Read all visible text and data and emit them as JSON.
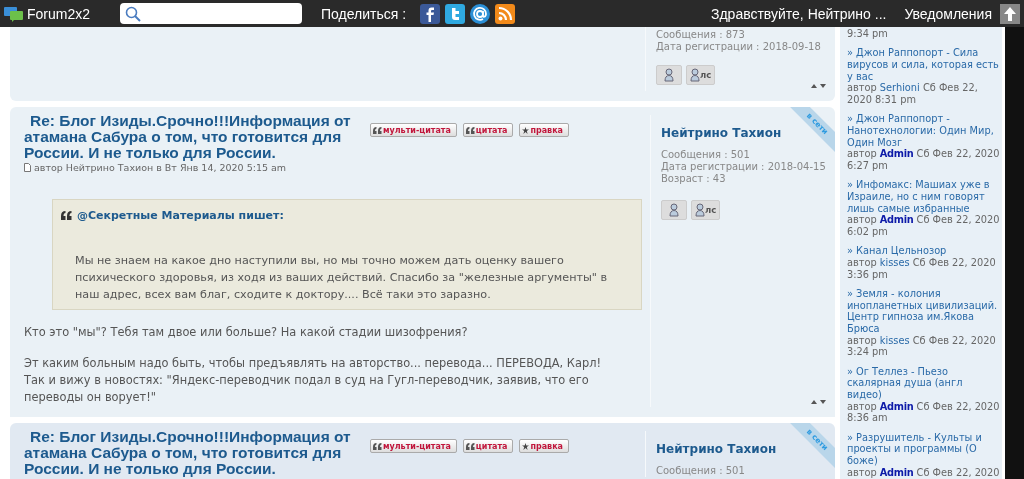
{
  "topbar": {
    "site_name": "Forum2x2",
    "share_label": "Поделиться :",
    "greeting": "Здравствуйте, Нейтрино ...",
    "notifications": "Уведомления"
  },
  "posts": [
    {
      "kind": "fragment",
      "profile": {
        "stats": [
          "Сообщения : 873",
          "Дата регистрации : 2018-09-18"
        ],
        "pm_label": "лс"
      }
    },
    {
      "kind": "full",
      "title": "Re: Блог Изиды.Срочно!!!Информация от атамана Сабура о том, что готовится для России. И не только для России.",
      "meta": "автор Нейтрино Тахион в Вт Янв 14, 2020 5:15 am",
      "buttons": [
        {
          "kind": "quote",
          "label": "мульти-цитата"
        },
        {
          "kind": "quote",
          "label": "цитата"
        },
        {
          "kind": "edit",
          "label": "правка"
        }
      ],
      "quote": {
        "author": "@Секретные Материалы",
        "says": "пишет:",
        "text": "Мы не знаем на какое дно наступили вы, но мы точно можем дать оценку вашего психического здоровья, из ходя из ваших действий. Спасибо за \"железные аргументы\" в наш адрес, всех вам благ, сходите к доктору....  Всё таки это заразно."
      },
      "paragraphs": [
        "Кто это \"мы\"? Тебя там двое или больше? На какой стадии шизофрения?",
        "Эт каким больным надо быть, чтобы предъявлять на авторство... перевода... ПЕРЕВОДА, Карл!\nТак и вижу в новостях: \"Яндекс-переводчик подал в суд на Гугл-переводчик, заявив, что его переводы он ворует!\""
      ],
      "profile": {
        "name": "Нейтрино Тахион",
        "online": true,
        "online_label": "в сети",
        "stats": [
          "Сообщения : 501",
          "Дата регистрации : 2018-04-15",
          "Возраст : 43"
        ],
        "pm_label": "лс"
      }
    },
    {
      "kind": "partial",
      "title": "Re: Блог Изиды.Срочно!!!Информация от атамана Сабура о том, что готовится для России. И не только для России.",
      "buttons": [
        {
          "kind": "quote",
          "label": "мульти-цитата"
        },
        {
          "kind": "quote",
          "label": "цитата"
        },
        {
          "kind": "edit",
          "label": "правка"
        }
      ],
      "profile": {
        "name": "Нейтрино Тахион",
        "online": true,
        "online_label": "в сети",
        "stats": [
          "Сообщения : 501"
        ]
      }
    }
  ],
  "sidebar": {
    "top_fragment": "9:34 pm",
    "items": [
      {
        "title": "» Джон Раппопорт - Сила вирусов и сила, которая есть у вас",
        "by": "автор",
        "author": "Serhioni",
        "date": "Сб Фев 22, 2020 8:31 pm"
      },
      {
        "title": "» Джон Раппопорт - Нанотехнологии: Один Мир, Один Мозг",
        "by": "автор",
        "author": "**Admin**",
        "date": "Сб Фев 22, 2020 6:27 pm"
      },
      {
        "title": "» Инфомакс: Машиах уже в Израиле, но с ним говорят лишь самые избранные",
        "by": "автор",
        "author": "**Admin**",
        "date": "Сб Фев 22, 2020 6:02 pm"
      },
      {
        "title": "» Канал Цельнозор",
        "by": "автор",
        "author": "kisses",
        "date": "Сб Фев 22, 2020 3:36 pm"
      },
      {
        "title": "» Земля - колония инопланетных цивилизаций. Центр гипноза им.Якова Брюса",
        "by": "автор",
        "author": "kisses",
        "date": "Сб Фев 22, 2020 3:24 pm"
      },
      {
        "title": "» Ог Теллез - Пьезо скалярная душа (англ видео)",
        "by": "автор",
        "author": "**Admin**",
        "date": "Сб Фев 22, 2020 8:36 am"
      },
      {
        "title": "» Разрушитель - Культы и проекты и программы (О боже)",
        "by": "автор",
        "author": "**Admin**",
        "date": "Сб Фев 22, 2020"
      }
    ]
  }
}
